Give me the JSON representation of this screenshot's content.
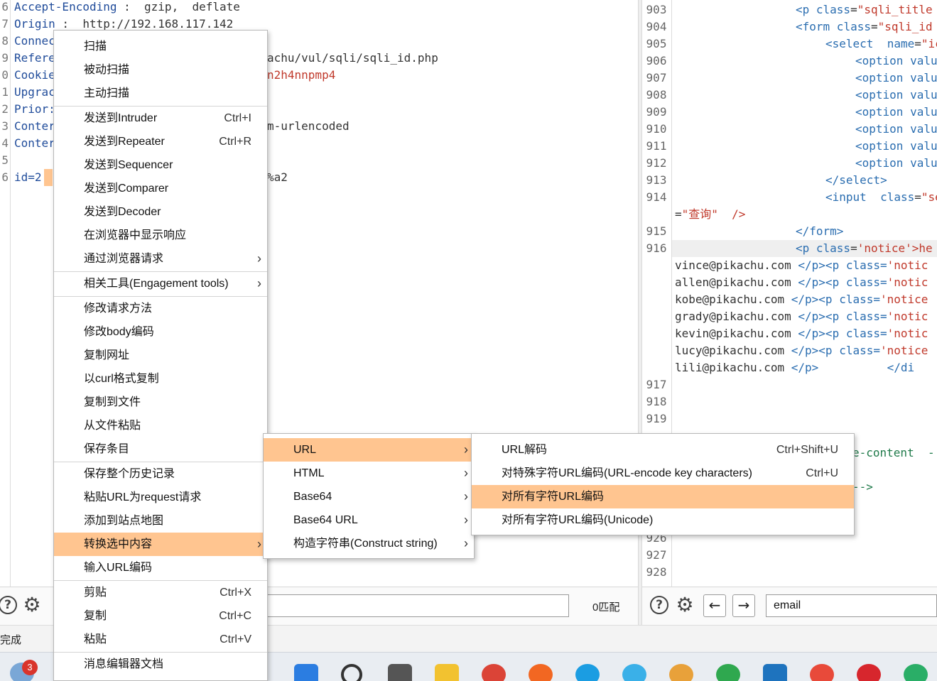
{
  "request_editor": {
    "line_numbers": [
      "6",
      "7",
      "8",
      "9",
      "0",
      "1",
      "2",
      "3",
      "4",
      "5",
      "6"
    ],
    "lines": [
      {
        "prefix": "Accept-Encoding",
        "rest": " :  gzip,  deflate"
      },
      {
        "prefix": "Origin",
        "rest": " :  http://192.168.117.142"
      },
      {
        "prefix": "Connec",
        "rest": ""
      },
      {
        "prefix": "Refere",
        "rest": ""
      },
      {
        "prefix": "Cookie",
        "rest": ""
      },
      {
        "prefix": "Upgrac",
        "rest": ""
      },
      {
        "prefix": "Prior:",
        "rest": ""
      },
      {
        "prefix": "Conter",
        "rest": ""
      },
      {
        "prefix": "Conter",
        "rest": ""
      },
      {
        "prefix": "",
        "rest": ""
      },
      {
        "prefix": "id=2",
        "rest": ""
      }
    ],
    "overflow_fragments": {
      "referer_tail": "achu/vul/sqli/sqli_id.php",
      "cookie_tail": "n2h4nnpmp4",
      "content_type_tail": "m-urlencoded",
      "id_tail": "%a2"
    }
  },
  "response_editor": {
    "line_numbers": [
      "903",
      "904",
      "905",
      "906",
      "907",
      "908",
      "909",
      "910",
      "911",
      "912",
      "913",
      "914",
      "",
      "915",
      "916",
      "",
      "",
      "",
      "",
      "",
      "",
      "",
      "917",
      "918",
      "919",
      "",
      "",
      "",
      "",
      "",
      "",
      "926",
      "927",
      "928"
    ],
    "lines": [
      {
        "indent": 170,
        "tag": "<p",
        "attr": " class",
        "eq": "=",
        "val": "\"sqli_title"
      },
      {
        "indent": 170,
        "tag": "<form",
        "attr": " class",
        "eq": "=",
        "val": "\"sqli_id"
      },
      {
        "indent": 212,
        "tag": "<select",
        "attr": "  name",
        "eq": "=",
        "val": "\"ic"
      },
      {
        "indent": 254,
        "tag": "<option",
        "attr": " valu",
        "eq": "",
        "val": ""
      },
      {
        "indent": 254,
        "tag": "<option",
        "attr": " valu",
        "eq": "",
        "val": ""
      },
      {
        "indent": 254,
        "tag": "<option",
        "attr": " valu",
        "eq": "",
        "val": ""
      },
      {
        "indent": 254,
        "tag": "<option",
        "attr": " valu",
        "eq": "",
        "val": ""
      },
      {
        "indent": 254,
        "tag": "<option",
        "attr": " valu",
        "eq": "",
        "val": ""
      },
      {
        "indent": 254,
        "tag": "<option",
        "attr": " valu",
        "eq": "",
        "val": ""
      },
      {
        "indent": 254,
        "tag": "<option",
        "attr": " valu",
        "eq": "",
        "val": ""
      },
      {
        "indent": 212,
        "tag": "</select",
        "attr": ">",
        "eq": "",
        "val": ""
      },
      {
        "indent": 212,
        "tag": "<input",
        "attr": "  class",
        "eq": "=",
        "val": "\"se"
      },
      {
        "indent": 0,
        "tag": "",
        "attr": "",
        "eq": "=",
        "val": "\"查询\"  />"
      },
      {
        "indent": 170,
        "tag": "</form",
        "attr": ">",
        "eq": "",
        "val": ""
      },
      {
        "indent": 170,
        "tag": "<p",
        "attr": " class",
        "eq": "=",
        "val": "'notice'>he"
      },
      {
        "indent": 0,
        "tag": "vince@pikachu.com",
        "attr": " </p><p",
        "eq": " class=",
        "val": "'notic"
      },
      {
        "indent": 0,
        "tag": "allen@pikachu.com",
        "attr": " </p><p",
        "eq": " class=",
        "val": "'notic"
      },
      {
        "indent": 0,
        "tag": "kobe@pikachu.com",
        "attr": " </p><p",
        "eq": " class=",
        "val": "'notice"
      },
      {
        "indent": 0,
        "tag": "grady@pikachu.com",
        "attr": " </p><p",
        "eq": " class=",
        "val": "'notic"
      },
      {
        "indent": 0,
        "tag": "kevin@pikachu.com",
        "attr": " </p><p",
        "eq": " class=",
        "val": "'notic"
      },
      {
        "indent": 0,
        "tag": "lucy@pikachu.com",
        "attr": " </p><p",
        "eq": " class=",
        "val": "'notice"
      },
      {
        "indent": 0,
        "tag": "lili@pikachu.com",
        "attr": " </p>",
        "eq": "          </di",
        "val": ""
      }
    ],
    "fragments": {
      "content_tail": "e-content  -",
      "comment_tail": "-->"
    }
  },
  "left_toolbar": {
    "match_count": "0匹配"
  },
  "right_toolbar": {
    "search_value": "email"
  },
  "status": {
    "text": "完成"
  },
  "taskbar": {
    "badge": "3"
  },
  "context_menu": {
    "items": [
      {
        "label": "扫描",
        "shortcut": "",
        "submenu": false
      },
      {
        "label": "被动扫描",
        "shortcut": "",
        "submenu": false
      },
      {
        "label": "主动扫描",
        "shortcut": "",
        "submenu": false
      },
      {
        "label": "发送到Intruder",
        "shortcut": "Ctrl+I",
        "submenu": false
      },
      {
        "label": "发送到Repeater",
        "shortcut": "Ctrl+R",
        "submenu": false
      },
      {
        "label": "发送到Sequencer",
        "shortcut": "",
        "submenu": false
      },
      {
        "label": "发送到Comparer",
        "shortcut": "",
        "submenu": false
      },
      {
        "label": "发送到Decoder",
        "shortcut": "",
        "submenu": false
      },
      {
        "label": "在浏览器中显示响应",
        "shortcut": "",
        "submenu": false
      },
      {
        "label": "通过浏览器请求",
        "shortcut": "",
        "submenu": true
      },
      {
        "label": "相关工具(Engagement tools)",
        "shortcut": "",
        "submenu": true
      },
      {
        "label": "修改请求方法",
        "shortcut": "",
        "submenu": false
      },
      {
        "label": "修改body编码",
        "shortcut": "",
        "submenu": false
      },
      {
        "label": "复制网址",
        "shortcut": "",
        "submenu": false
      },
      {
        "label": "以curl格式复制",
        "shortcut": "",
        "submenu": false
      },
      {
        "label": "复制到文件",
        "shortcut": "",
        "submenu": false
      },
      {
        "label": "从文件粘贴",
        "shortcut": "",
        "submenu": false
      },
      {
        "label": "保存条目",
        "shortcut": "",
        "submenu": false
      },
      {
        "label": "保存整个历史记录",
        "shortcut": "",
        "submenu": false
      },
      {
        "label": "粘贴URL为request请求",
        "shortcut": "",
        "submenu": false
      },
      {
        "label": "添加到站点地图",
        "shortcut": "",
        "submenu": false
      },
      {
        "label": "转换选中内容",
        "shortcut": "",
        "submenu": true
      },
      {
        "label": "输入URL编码",
        "shortcut": "",
        "submenu": false
      },
      {
        "label": "剪贴",
        "shortcut": "Ctrl+X",
        "submenu": false
      },
      {
        "label": "复制",
        "shortcut": "Ctrl+C",
        "submenu": false
      },
      {
        "label": "粘贴",
        "shortcut": "Ctrl+V",
        "submenu": false
      },
      {
        "label": "消息编辑器文档",
        "shortcut": "",
        "submenu": false
      }
    ]
  },
  "convert_submenu": {
    "items": [
      {
        "label": "URL"
      },
      {
        "label": "HTML"
      },
      {
        "label": "Base64"
      },
      {
        "label": "Base64 URL"
      },
      {
        "label": "构造字符串(Construct string)"
      }
    ]
  },
  "url_submenu": {
    "items": [
      {
        "label": "URL解码",
        "shortcut": "Ctrl+Shift+U"
      },
      {
        "label": "对特殊字符URL编码(URL-encode key characters)",
        "shortcut": "Ctrl+U"
      },
      {
        "label": "对所有字符URL编码",
        "shortcut": ""
      },
      {
        "label": "对所有字符URL编码(Unicode)",
        "shortcut": ""
      }
    ]
  },
  "colors": {
    "highlight": "#ffc590",
    "tag_blue": "#2a6db0",
    "value_red": "#c0392b"
  }
}
